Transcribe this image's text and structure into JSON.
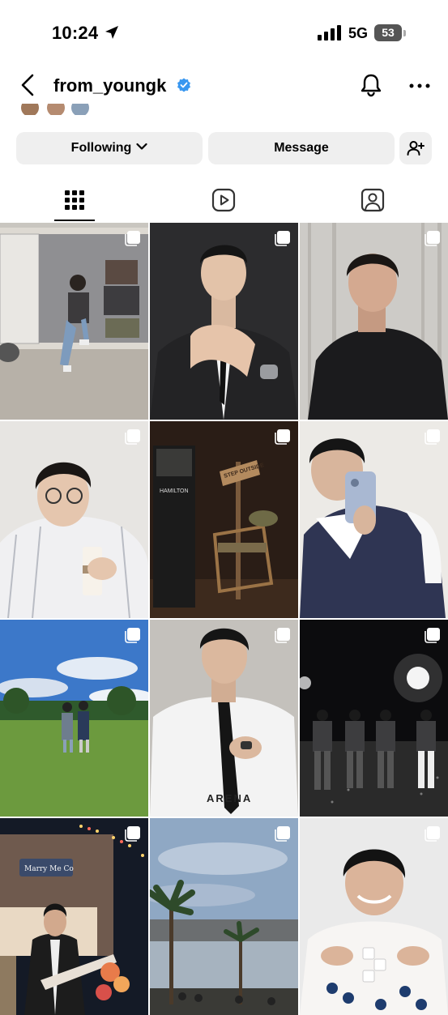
{
  "status_bar": {
    "time": "10:24",
    "network": "5G",
    "battery": "53"
  },
  "header": {
    "username": "from_youngk",
    "icons": [
      "back-arrow-icon",
      "verified-badge-icon",
      "bell-icon",
      "more-icon"
    ]
  },
  "actions": {
    "following_label": "Following",
    "message_label": "Message",
    "add_user_icon": "add-user-icon"
  },
  "tabs": [
    {
      "name": "posts",
      "icon": "grid-icon",
      "active": true
    },
    {
      "name": "reels",
      "icon": "reels-icon",
      "active": false
    },
    {
      "name": "tagged",
      "icon": "tagged-icon",
      "active": false
    }
  ],
  "posts": [
    {
      "scene": "man sitting in van doorway",
      "overlay_text": ""
    },
    {
      "scene": "man in black suit with watch, dark background",
      "overlay_text": ""
    },
    {
      "scene": "man in black t-shirt selfie, curtain background",
      "overlay_text": ""
    },
    {
      "scene": "man with glasses holding bottle",
      "overlay_text": ""
    },
    {
      "scene": "dark set with chair and signpost",
      "overlay_text": "STEP OUTSIDE",
      "watch_brand": "HAMILTON"
    },
    {
      "scene": "mirror selfie in vest",
      "overlay_text": ""
    },
    {
      "scene": "two men on grass field under blue sky",
      "overlay_text": ""
    },
    {
      "scene": "man in white shirt with black tie",
      "overlay_text": "ARENA"
    },
    {
      "scene": "group on concert stage with lights",
      "overlay_text": ""
    },
    {
      "scene": "man with bass guitar at night store",
      "overlay_text": "Marry Me Co"
    },
    {
      "scene": "palm trees and lake at dusk",
      "overlay_text": ""
    },
    {
      "scene": "smiling man with game pieces",
      "overlay_text": ""
    }
  ],
  "colors": {
    "verified": "#3897f0",
    "button_bg": "#efefef"
  }
}
